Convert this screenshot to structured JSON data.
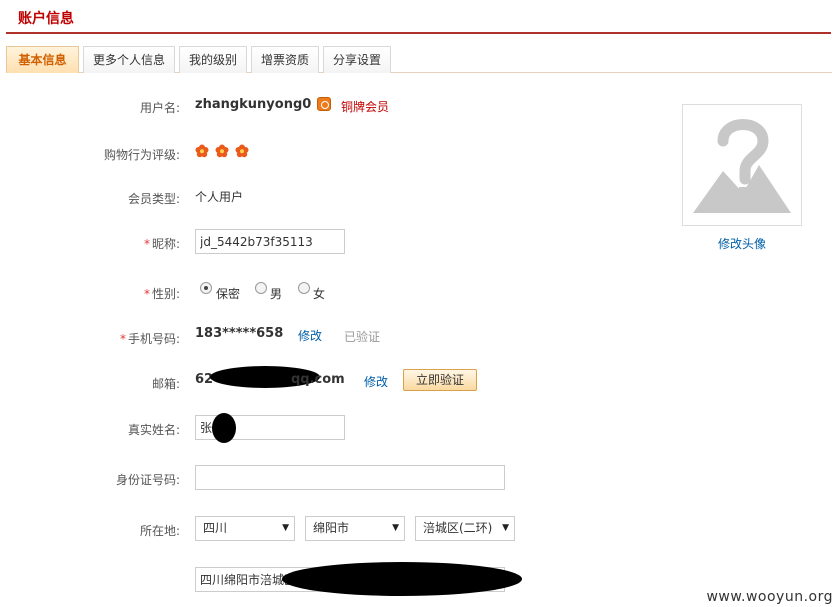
{
  "header": {
    "title": "账户信息"
  },
  "tabs": [
    {
      "label": "基本信息",
      "active": true
    },
    {
      "label": "更多个人信息",
      "active": false
    },
    {
      "label": "我的级别",
      "active": false
    },
    {
      "label": "增票资质",
      "active": false
    },
    {
      "label": "分享设置",
      "active": false
    }
  ],
  "form": {
    "username": {
      "label": "用户名:",
      "value": "zhangkunyong0",
      "badge": "铜牌会员"
    },
    "rating": {
      "label": "购物行为评级:",
      "count": 3,
      "icon": "flower-icon"
    },
    "member_type": {
      "label": "会员类型:",
      "value": "个人用户"
    },
    "nickname": {
      "required_mark": "*",
      "label": "昵称:",
      "value": "jd_5442b73f35113"
    },
    "gender": {
      "required_mark": "*",
      "label": "性别:",
      "options": [
        "保密",
        "男",
        "女"
      ],
      "selected": "保密"
    },
    "phone": {
      "required_mark": "*",
      "label": "手机号码:",
      "value": "183*****658",
      "edit": "修改",
      "status": "已验证"
    },
    "email": {
      "label": "邮箱:",
      "value_prefix": "62",
      "value_suffix": "qq.com",
      "edit": "修改",
      "verify_button": "立即验证"
    },
    "real_name": {
      "label": "真实姓名:",
      "value": "张"
    },
    "id_number": {
      "label": "身份证号码:",
      "value": ""
    },
    "location": {
      "label": "所在地:",
      "province": "四川",
      "city": "绵阳市",
      "district": "涪城区(二环)"
    },
    "address": {
      "value": "四川绵阳市涪城区(二环"
    }
  },
  "avatar": {
    "link": "修改头像"
  },
  "watermark": "www.wooyun.org",
  "colors": {
    "accent": "#c00000",
    "link": "#005ea7",
    "required": "#e4393c",
    "tab_active": "#d06000"
  }
}
